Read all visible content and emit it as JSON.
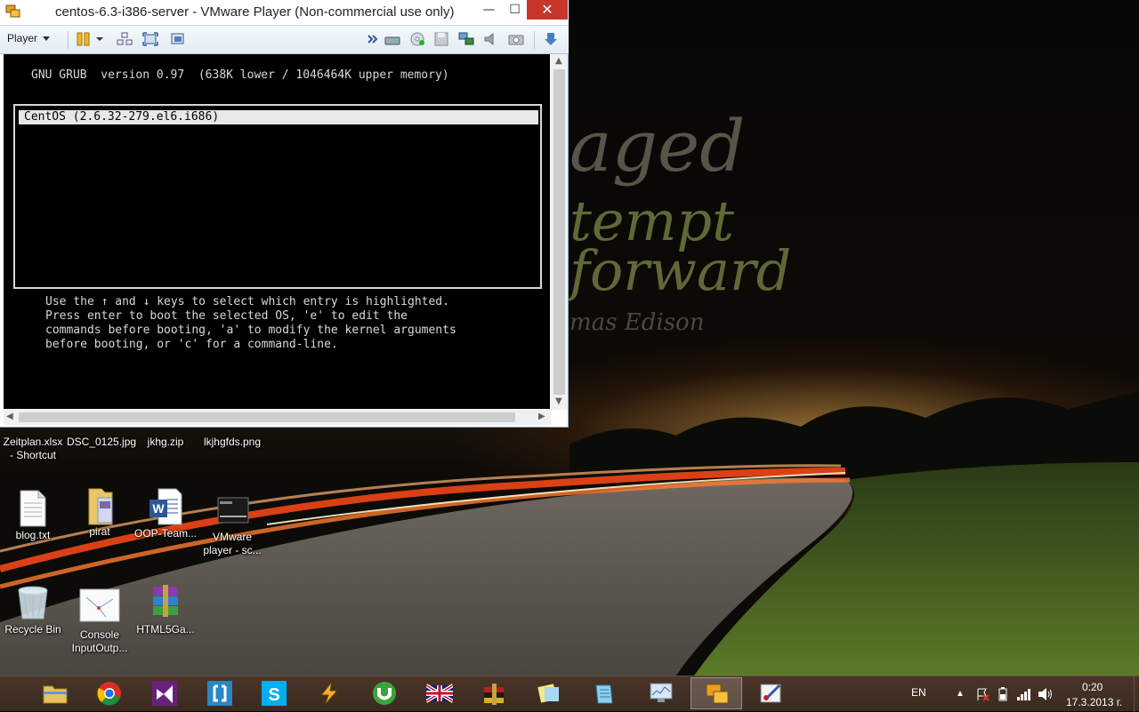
{
  "wallpaper": {
    "quote_lines": [
      "aged",
      "tempt",
      "forward",
      "mas Edison"
    ]
  },
  "window": {
    "title": "centos-6.3-i386-server - VMware Player (Non-commercial use only)",
    "minimize": "—",
    "maximize": "☐",
    "close": "✕",
    "menu_label": "Player"
  },
  "grub": {
    "header": "GNU GRUB  version 0.97  (638K lower / 1046464K upper memory)",
    "entries": [
      "CentOS (2.6.32-279.el6.i686)"
    ],
    "help_lines": [
      "Use the ↑ and ↓ keys to select which entry is highlighted.",
      "Press enter to boot the selected OS, 'e' to edit the",
      "commands before booting, 'a' to modify the kernel arguments",
      "before booting, or 'c' for a command-line."
    ]
  },
  "desktop": {
    "row1": [
      "Zeitplan.xlsx - Shortcut",
      "DSC_0125.jpg",
      "jkhg.zip",
      "lkjhgfds.png"
    ],
    "row2": [
      "blog.txt",
      "pirat",
      "OOP-Team...",
      "VMware player - sc..."
    ],
    "row3": [
      "Recycle Bin",
      "Console InputOutp...",
      "HTML5Ga..."
    ]
  },
  "taskbar": {
    "apps": [
      "File Explorer",
      "Google Chrome",
      "Visual Studio",
      "Brackets",
      "Skype",
      "Winamp",
      "uTorrent",
      "Language flag",
      "WinRAR",
      "Sticky notes",
      "Notepad",
      "Resource monitor",
      "VMware Player",
      "Paint"
    ],
    "active_index": 12,
    "language": "EN",
    "time": "0:20",
    "date": "17.3.2013 г."
  },
  "colors": {
    "close_button": "#c7352b",
    "taskbar": "#3a2a20",
    "grub_text": "#d8d8d8"
  }
}
